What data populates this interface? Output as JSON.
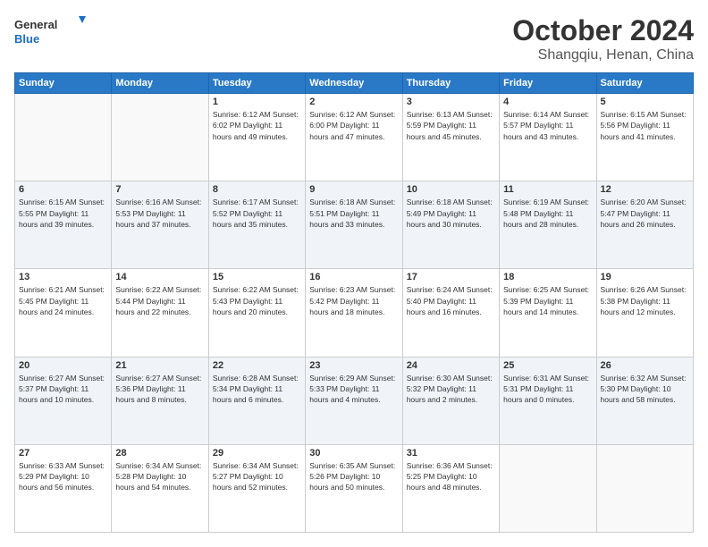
{
  "header": {
    "logo_line1": "General",
    "logo_line2": "Blue",
    "month_year": "October 2024",
    "location": "Shangqiu, Henan, China"
  },
  "weekdays": [
    "Sunday",
    "Monday",
    "Tuesday",
    "Wednesday",
    "Thursday",
    "Friday",
    "Saturday"
  ],
  "weeks": [
    [
      {
        "day": "",
        "info": ""
      },
      {
        "day": "",
        "info": ""
      },
      {
        "day": "1",
        "info": "Sunrise: 6:12 AM\nSunset: 6:02 PM\nDaylight: 11 hours and 49 minutes."
      },
      {
        "day": "2",
        "info": "Sunrise: 6:12 AM\nSunset: 6:00 PM\nDaylight: 11 hours and 47 minutes."
      },
      {
        "day": "3",
        "info": "Sunrise: 6:13 AM\nSunset: 5:59 PM\nDaylight: 11 hours and 45 minutes."
      },
      {
        "day": "4",
        "info": "Sunrise: 6:14 AM\nSunset: 5:57 PM\nDaylight: 11 hours and 43 minutes."
      },
      {
        "day": "5",
        "info": "Sunrise: 6:15 AM\nSunset: 5:56 PM\nDaylight: 11 hours and 41 minutes."
      }
    ],
    [
      {
        "day": "6",
        "info": "Sunrise: 6:15 AM\nSunset: 5:55 PM\nDaylight: 11 hours and 39 minutes."
      },
      {
        "day": "7",
        "info": "Sunrise: 6:16 AM\nSunset: 5:53 PM\nDaylight: 11 hours and 37 minutes."
      },
      {
        "day": "8",
        "info": "Sunrise: 6:17 AM\nSunset: 5:52 PM\nDaylight: 11 hours and 35 minutes."
      },
      {
        "day": "9",
        "info": "Sunrise: 6:18 AM\nSunset: 5:51 PM\nDaylight: 11 hours and 33 minutes."
      },
      {
        "day": "10",
        "info": "Sunrise: 6:18 AM\nSunset: 5:49 PM\nDaylight: 11 hours and 30 minutes."
      },
      {
        "day": "11",
        "info": "Sunrise: 6:19 AM\nSunset: 5:48 PM\nDaylight: 11 hours and 28 minutes."
      },
      {
        "day": "12",
        "info": "Sunrise: 6:20 AM\nSunset: 5:47 PM\nDaylight: 11 hours and 26 minutes."
      }
    ],
    [
      {
        "day": "13",
        "info": "Sunrise: 6:21 AM\nSunset: 5:45 PM\nDaylight: 11 hours and 24 minutes."
      },
      {
        "day": "14",
        "info": "Sunrise: 6:22 AM\nSunset: 5:44 PM\nDaylight: 11 hours and 22 minutes."
      },
      {
        "day": "15",
        "info": "Sunrise: 6:22 AM\nSunset: 5:43 PM\nDaylight: 11 hours and 20 minutes."
      },
      {
        "day": "16",
        "info": "Sunrise: 6:23 AM\nSunset: 5:42 PM\nDaylight: 11 hours and 18 minutes."
      },
      {
        "day": "17",
        "info": "Sunrise: 6:24 AM\nSunset: 5:40 PM\nDaylight: 11 hours and 16 minutes."
      },
      {
        "day": "18",
        "info": "Sunrise: 6:25 AM\nSunset: 5:39 PM\nDaylight: 11 hours and 14 minutes."
      },
      {
        "day": "19",
        "info": "Sunrise: 6:26 AM\nSunset: 5:38 PM\nDaylight: 11 hours and 12 minutes."
      }
    ],
    [
      {
        "day": "20",
        "info": "Sunrise: 6:27 AM\nSunset: 5:37 PM\nDaylight: 11 hours and 10 minutes."
      },
      {
        "day": "21",
        "info": "Sunrise: 6:27 AM\nSunset: 5:36 PM\nDaylight: 11 hours and 8 minutes."
      },
      {
        "day": "22",
        "info": "Sunrise: 6:28 AM\nSunset: 5:34 PM\nDaylight: 11 hours and 6 minutes."
      },
      {
        "day": "23",
        "info": "Sunrise: 6:29 AM\nSunset: 5:33 PM\nDaylight: 11 hours and 4 minutes."
      },
      {
        "day": "24",
        "info": "Sunrise: 6:30 AM\nSunset: 5:32 PM\nDaylight: 11 hours and 2 minutes."
      },
      {
        "day": "25",
        "info": "Sunrise: 6:31 AM\nSunset: 5:31 PM\nDaylight: 11 hours and 0 minutes."
      },
      {
        "day": "26",
        "info": "Sunrise: 6:32 AM\nSunset: 5:30 PM\nDaylight: 10 hours and 58 minutes."
      }
    ],
    [
      {
        "day": "27",
        "info": "Sunrise: 6:33 AM\nSunset: 5:29 PM\nDaylight: 10 hours and 56 minutes."
      },
      {
        "day": "28",
        "info": "Sunrise: 6:34 AM\nSunset: 5:28 PM\nDaylight: 10 hours and 54 minutes."
      },
      {
        "day": "29",
        "info": "Sunrise: 6:34 AM\nSunset: 5:27 PM\nDaylight: 10 hours and 52 minutes."
      },
      {
        "day": "30",
        "info": "Sunrise: 6:35 AM\nSunset: 5:26 PM\nDaylight: 10 hours and 50 minutes."
      },
      {
        "day": "31",
        "info": "Sunrise: 6:36 AM\nSunset: 5:25 PM\nDaylight: 10 hours and 48 minutes."
      },
      {
        "day": "",
        "info": ""
      },
      {
        "day": "",
        "info": ""
      }
    ]
  ]
}
